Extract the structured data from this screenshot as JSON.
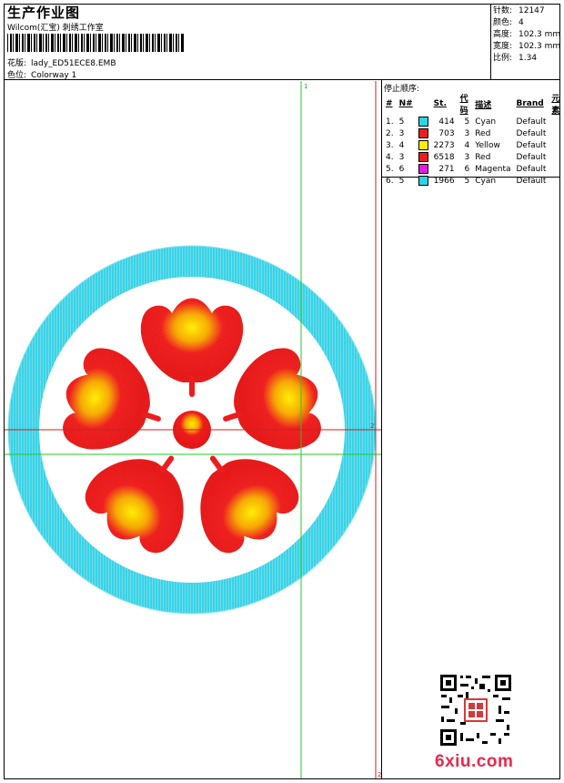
{
  "header": {
    "title": "生产作业图",
    "subtitle": "Wilcom(汇宝) 刺绣工作室",
    "design_label": "花版:",
    "design_value": "lady_ED51ECE8.EMB",
    "colorway_label": "色位:",
    "colorway_value": "Colorway 1"
  },
  "stats": [
    {
      "label": "针数:",
      "value": "12147"
    },
    {
      "label": "颜色:",
      "value": "4"
    },
    {
      "label": "高度:",
      "value": "102.3 mm"
    },
    {
      "label": "宽度:",
      "value": "102.3 mm"
    },
    {
      "label": "比例:",
      "value": "1.34"
    }
  ],
  "stop_sequence": {
    "title": "停止顺序:",
    "columns": [
      "#",
      "N#",
      "St.",
      "代码",
      "描述",
      "Brand",
      "元素"
    ],
    "rows": [
      {
        "index": "1.",
        "needle": "5",
        "color": "#29d6e6",
        "stitches": "414",
        "code": "5",
        "name": "Cyan",
        "brand": "Default"
      },
      {
        "index": "2.",
        "needle": "3",
        "color": "#ee1c1c",
        "stitches": "703",
        "code": "3",
        "name": "Red",
        "brand": "Default"
      },
      {
        "index": "3.",
        "needle": "4",
        "color": "#ffee00",
        "stitches": "2273",
        "code": "4",
        "name": "Yellow",
        "brand": "Default"
      },
      {
        "index": "4.",
        "needle": "3",
        "color": "#ee1c1c",
        "stitches": "6518",
        "code": "3",
        "name": "Red",
        "brand": "Default"
      },
      {
        "index": "5.",
        "needle": "6",
        "color": "#e41ce4",
        "stitches": "271",
        "code": "6",
        "name": "Magenta",
        "brand": "Default"
      },
      {
        "index": "6.",
        "needle": "5",
        "color": "#29d6e6",
        "stitches": "1966",
        "code": "5",
        "name": "Cyan",
        "brand": "Default"
      }
    ]
  },
  "canvas": {
    "marker_top": "1",
    "marker_right": "2",
    "marker_bottom": "2"
  },
  "colors": {
    "ring": "#3ad2e6",
    "petal": "#ee1c1c",
    "highlight": "#ffee00",
    "crosshair_green": "#22cc22",
    "crosshair_red": "#cc2222"
  },
  "watermark": {
    "qr_icon": "qr-code-icon",
    "seal_icon": "seal-stamp-icon",
    "site_logo": "6xiu.com"
  }
}
